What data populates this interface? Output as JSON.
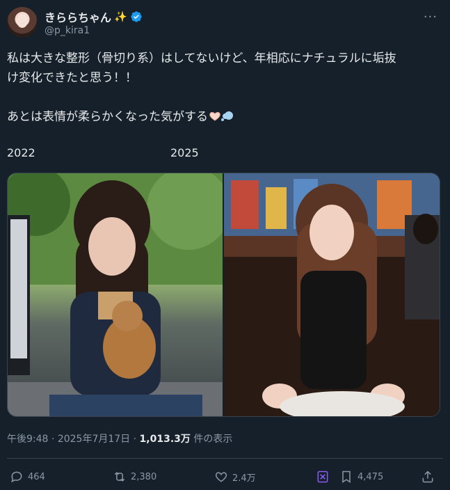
{
  "user": {
    "display_name": "きららちゃん",
    "sparkle": "✨",
    "handle": "@p_kira1",
    "avatar_icon": "avatar-photo",
    "verified_icon": "verified-badge-icon",
    "more_label": "···"
  },
  "tweet": {
    "line1": "私は大きな整形（骨切り系）はしてないけど、年相応にナチュラルに垢抜",
    "line2": "け変化できたと思う！！",
    "line3": "あとは表情が柔らかくなった気がする",
    "year_left": "2022",
    "year_right": "2025"
  },
  "meta": {
    "time": "午後9:48",
    "sep1": " · ",
    "date": "2025年7月17日",
    "sep2": " · ",
    "views": "1,013.3万",
    "views_suffix": " 件の表示"
  },
  "actions": {
    "replies": "464",
    "reposts": "2,380",
    "likes": "2.4万",
    "bookmarks": "4,475"
  },
  "colors": {
    "background": "#15202b",
    "text": "#e7e9ea",
    "secondary": "#8b98a5",
    "verified": "#1d9bf0",
    "grok": "#8b5cf6"
  }
}
